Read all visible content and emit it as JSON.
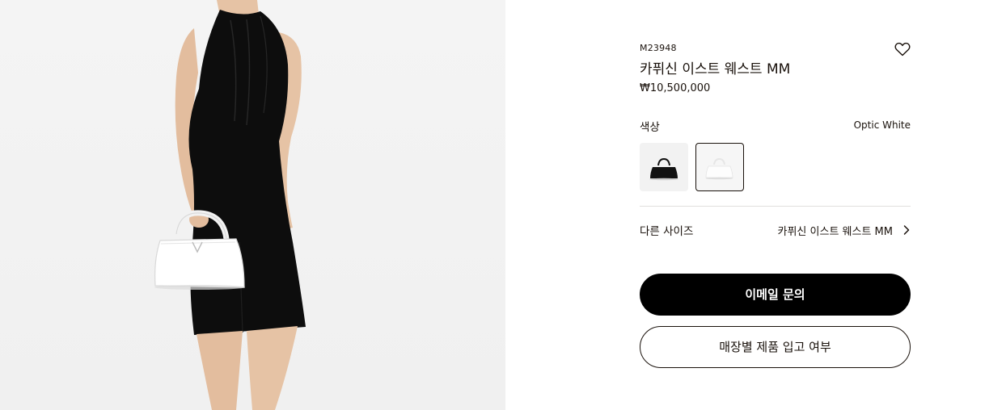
{
  "product": {
    "sku": "M23948",
    "title": "카퓌신 이스트 웨스트 MM",
    "price": "₩10,500,000"
  },
  "color": {
    "label": "색상",
    "selected": "Optic White",
    "swatches": [
      {
        "name": "black",
        "color": "#111111"
      },
      {
        "name": "optic-white",
        "color": "#f8f8f8"
      }
    ]
  },
  "size": {
    "label": "다른 사이즈",
    "value": "카퓌신 이스트 웨스트 MM"
  },
  "actions": {
    "email_label": "이메일 문의",
    "store_label": "매장별 제품 입고 여부"
  },
  "icons": {
    "wishlist": "heart-icon",
    "size_arrow": "chevron-right-icon"
  },
  "colors": {
    "primary_button": "#000000",
    "text": "#19110b",
    "divider": "#e1dfdd"
  }
}
